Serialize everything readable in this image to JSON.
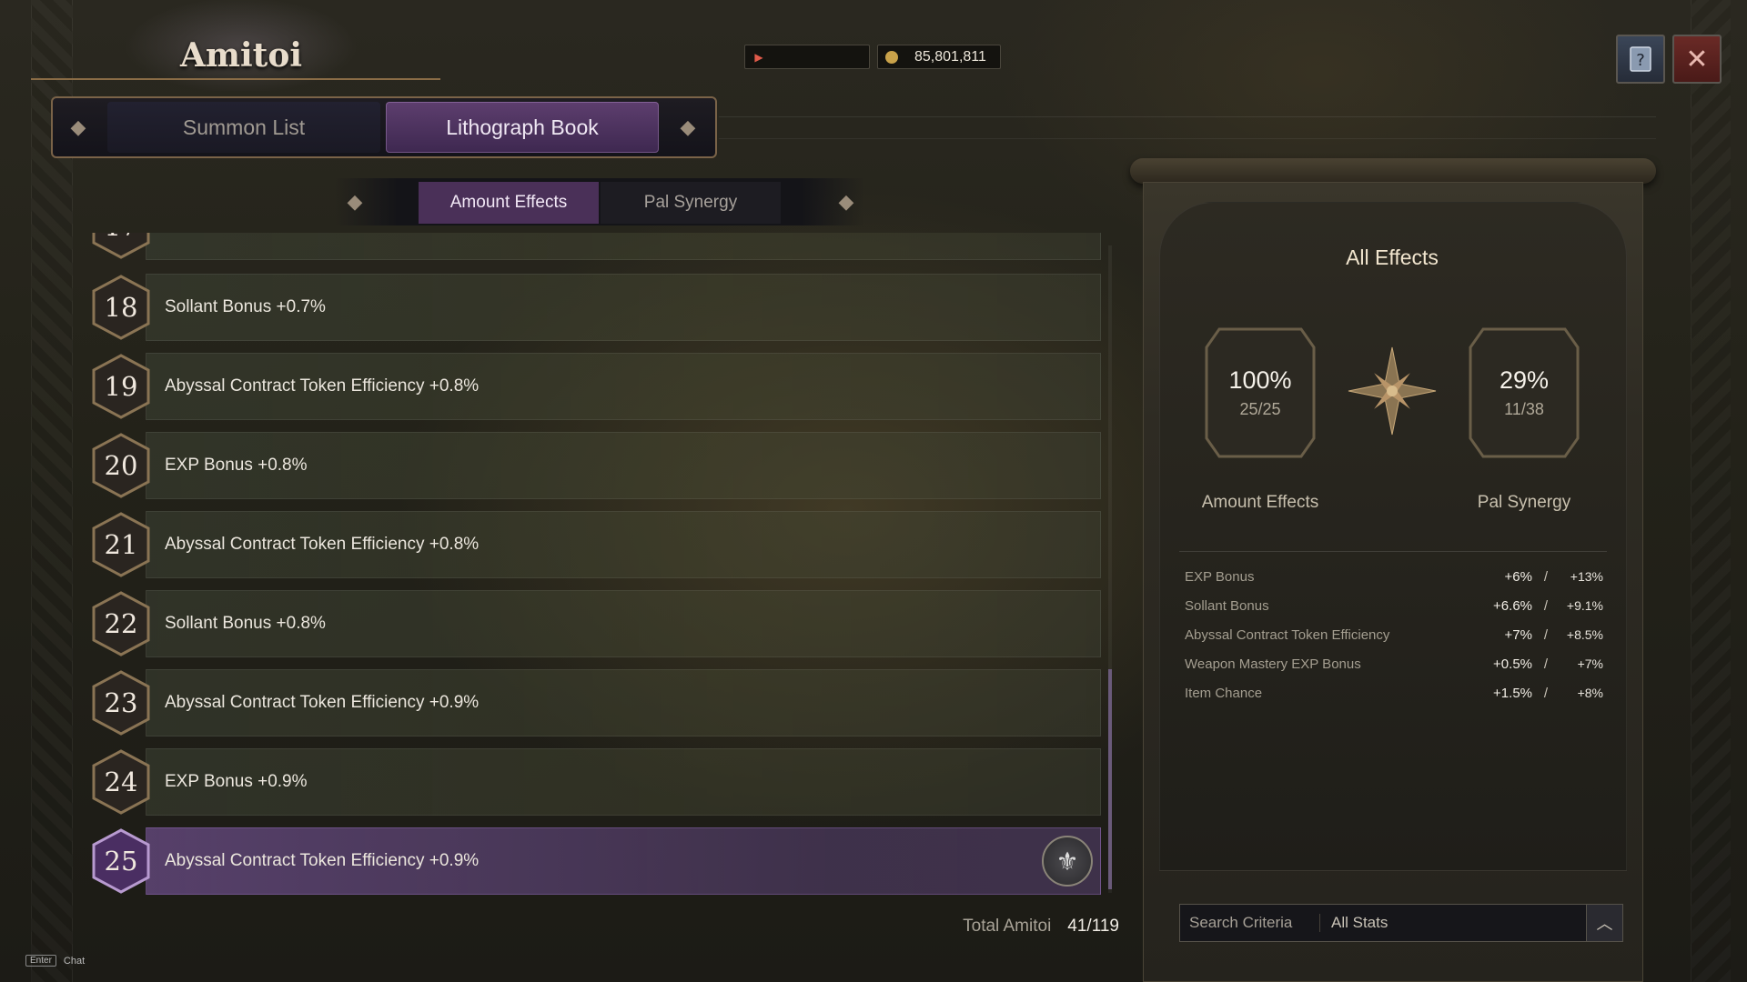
{
  "header": {
    "title": "Amitoi",
    "tabs": [
      {
        "label": "Summon List",
        "active": false
      },
      {
        "label": "Lithograph Book",
        "active": true
      }
    ]
  },
  "currency": {
    "ticket_value": "",
    "gold_value": "85,801,811"
  },
  "top_buttons": {
    "help_icon": "help-book-icon",
    "close_icon": "close-x-icon"
  },
  "sub_tabs": [
    {
      "label": "Amount Effects",
      "active": true
    },
    {
      "label": "Pal Synergy",
      "active": false
    }
  ],
  "list": {
    "partial_row": {
      "number": "17",
      "text": ""
    },
    "rows": [
      {
        "number": "18",
        "text": "Sollant Bonus +0.7%",
        "selected": false
      },
      {
        "number": "19",
        "text": "Abyssal Contract Token Efficiency +0.8%",
        "selected": false
      },
      {
        "number": "20",
        "text": "EXP Bonus +0.8%",
        "selected": false
      },
      {
        "number": "21",
        "text": "Abyssal Contract Token Efficiency +0.8%",
        "selected": false
      },
      {
        "number": "22",
        "text": "Sollant Bonus +0.8%",
        "selected": false
      },
      {
        "number": "23",
        "text": "Abyssal Contract Token Efficiency +0.9%",
        "selected": false
      },
      {
        "number": "24",
        "text": "EXP Bonus +0.9%",
        "selected": false
      },
      {
        "number": "25",
        "text": "Abyssal Contract Token Efficiency +0.9%",
        "selected": true
      }
    ],
    "selected_emblem_icon": "fleur-de-lis-icon"
  },
  "total": {
    "label": "Total Amitoi",
    "value": "41/119"
  },
  "chat_hint": {
    "key": "Enter",
    "label": "Chat"
  },
  "panel": {
    "title": "All Effects",
    "amount": {
      "percent": "100%",
      "fraction": "25/25",
      "label": "Amount Effects"
    },
    "synergy": {
      "percent": "29%",
      "fraction": "11/38",
      "label": "Pal Synergy"
    },
    "effects": [
      {
        "name": "EXP Bonus",
        "amount": "+6%",
        "sep": "/",
        "synergy": "+13%"
      },
      {
        "name": "Sollant Bonus",
        "amount": "+6.6%",
        "sep": "/",
        "synergy": "+9.1%"
      },
      {
        "name": "Abyssal Contract Token Efficiency",
        "amount": "+7%",
        "sep": "/",
        "synergy": "+8.5%"
      },
      {
        "name": "Weapon Mastery EXP Bonus",
        "amount": "+0.5%",
        "sep": "/",
        "synergy": "+7%"
      },
      {
        "name": "Item Chance",
        "amount": "+1.5%",
        "sep": "/",
        "synergy": "+8%"
      }
    ]
  },
  "search": {
    "label": "Search Criteria",
    "value": "All Stats"
  },
  "colors": {
    "accent_purple": "#5d3e6e",
    "gold_trim": "#7a6348",
    "panel_bg": "#2e2b23"
  }
}
